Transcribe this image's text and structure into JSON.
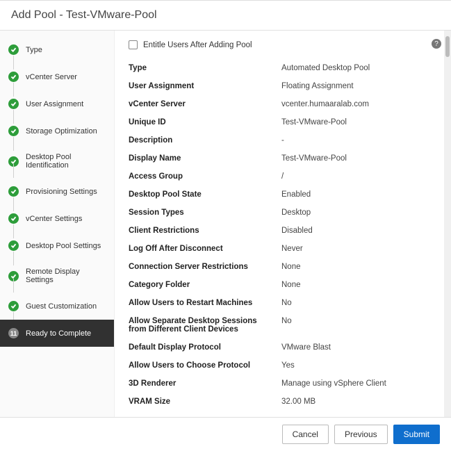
{
  "header": {
    "title": "Add Pool - Test-VMware-Pool"
  },
  "sidebar": {
    "steps": [
      {
        "label": "Type",
        "done": true
      },
      {
        "label": "vCenter Server",
        "done": true
      },
      {
        "label": "User Assignment",
        "done": true
      },
      {
        "label": "Storage Optimization",
        "done": true
      },
      {
        "label": "Desktop Pool Identification",
        "done": true
      },
      {
        "label": "Provisioning Settings",
        "done": true
      },
      {
        "label": "vCenter Settings",
        "done": true
      },
      {
        "label": "Desktop Pool Settings",
        "done": true
      },
      {
        "label": "Remote Display Settings",
        "done": true
      },
      {
        "label": "Guest Customization",
        "done": true
      },
      {
        "label": "Ready to Complete",
        "done": false,
        "num": "11"
      }
    ]
  },
  "main": {
    "entitle_label": "Entitle Users After Adding Pool",
    "rows": [
      {
        "k": "Type",
        "v": "Automated Desktop Pool"
      },
      {
        "k": "User Assignment",
        "v": "Floating Assignment"
      },
      {
        "k": "vCenter Server",
        "v": "vcenter.humaaralab.com"
      },
      {
        "k": "Unique ID",
        "v": "Test-VMware-Pool"
      },
      {
        "k": "Description",
        "v": "-"
      },
      {
        "k": "Display Name",
        "v": "Test-VMware-Pool"
      },
      {
        "k": "Access Group",
        "v": "/"
      },
      {
        "k": "Desktop Pool State",
        "v": "Enabled"
      },
      {
        "k": "Session Types",
        "v": "Desktop"
      },
      {
        "k": "Client Restrictions",
        "v": "Disabled"
      },
      {
        "k": "Log Off After Disconnect",
        "v": "Never"
      },
      {
        "k": "Connection Server Restrictions",
        "v": "None"
      },
      {
        "k": "Category Folder",
        "v": "None"
      },
      {
        "k": "Allow Users to Restart Machines",
        "v": "No"
      },
      {
        "k": "Allow Separate Desktop Sessions from Different Client Devices",
        "v": "No"
      },
      {
        "k": "Default Display Protocol",
        "v": "VMware Blast"
      },
      {
        "k": "Allow Users to Choose Protocol",
        "v": "Yes"
      },
      {
        "k": "3D Renderer",
        "v": "Manage using vSphere Client"
      },
      {
        "k": "VRAM Size",
        "v": "32.00 MB"
      }
    ]
  },
  "footer": {
    "cancel": "Cancel",
    "previous": "Previous",
    "submit": "Submit"
  }
}
